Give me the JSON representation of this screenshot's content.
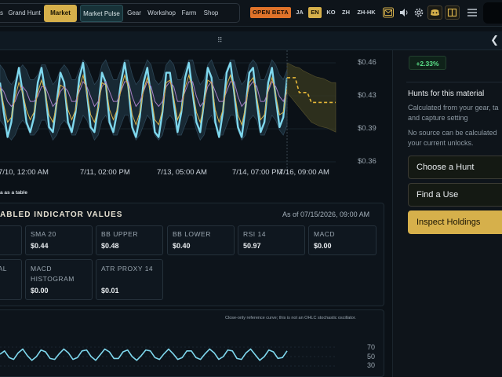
{
  "nav": {
    "items": [
      {
        "label": "s",
        "name": "nav-item-s"
      },
      {
        "label": "Grand Hunt",
        "name": "nav-item-grand-hunt"
      },
      {
        "label": "Market",
        "name": "nav-item-market"
      },
      {
        "label": "Market Pulse",
        "name": "nav-item-market-pulse"
      },
      {
        "label": "Gear",
        "name": "nav-item-gear"
      },
      {
        "label": "Workshop",
        "name": "nav-item-workshop"
      },
      {
        "label": "Farm",
        "name": "nav-item-farm"
      },
      {
        "label": "Shop",
        "name": "nav-item-shop"
      }
    ],
    "beta": "OPEN BETA",
    "languages": [
      "JA",
      "EN",
      "KO",
      "ZH",
      "ZH-HK"
    ],
    "active_language": "EN",
    "icons": [
      "mail-icon",
      "speaker-icon",
      "gear-icon",
      "discord-icon",
      "book-icon"
    ]
  },
  "colors": {
    "accent": "#d6b04b",
    "price_line": "#7fd8ee",
    "sma_line": "#d9b24a",
    "band_line": "#a77fc4",
    "forecast": "#e6b838",
    "positive": "#5ce38a"
  },
  "chart_data": {
    "type": "line",
    "y_ticks": [
      "$0.46",
      "$0.43",
      "$0.39",
      "$0.36"
    ],
    "x_ticks": [
      "7/10, 12:00 AM",
      "7/11, 02:00 PM",
      "7/13, 05:00 AM",
      "7/14, 07:00 PM",
      "7/16, 09:00 AM"
    ],
    "ylim": [
      0.36,
      0.46
    ],
    "series": [],
    "price_series": [
      0.44,
      0.41,
      0.385,
      0.4,
      0.435,
      0.455,
      0.43,
      0.4,
      0.39,
      0.405,
      0.44,
      0.455,
      0.43,
      0.395,
      0.39,
      0.42,
      0.45,
      0.44,
      0.4,
      0.39,
      0.41,
      0.445,
      0.46,
      0.43,
      0.395,
      0.39,
      0.415,
      0.45,
      0.44,
      0.4,
      0.39,
      0.41,
      0.44,
      0.46,
      0.435,
      0.395,
      0.385,
      0.405,
      0.44,
      0.455,
      0.425,
      0.39,
      0.385,
      0.41,
      0.45,
      0.45,
      0.42,
      0.39,
      0.41,
      0.445,
      0.46,
      0.43,
      0.4,
      0.39,
      0.42,
      0.455,
      0.445,
      0.4,
      0.385,
      0.41,
      0.45,
      0.46,
      0.43,
      0.395,
      0.385,
      0.415,
      0.45,
      0.455,
      0.42,
      0.39,
      0.4,
      0.44,
      0.455,
      0.425,
      0.395,
      0.405,
      0.445
    ],
    "sma_series": [
      0.43,
      0.425,
      0.415,
      0.41,
      0.415,
      0.425,
      0.43,
      0.425,
      0.415,
      0.415,
      0.42,
      0.43,
      0.43,
      0.42,
      0.41,
      0.415,
      0.425,
      0.43,
      0.425,
      0.415,
      0.415,
      0.425,
      0.435,
      0.43,
      0.42,
      0.41,
      0.415,
      0.43,
      0.435,
      0.425,
      0.415,
      0.415,
      0.425,
      0.435,
      0.435,
      0.42,
      0.41,
      0.415,
      0.425,
      0.435,
      0.43,
      0.415,
      0.41,
      0.415,
      0.43,
      0.435,
      0.43,
      0.415,
      0.415,
      0.425,
      0.435,
      0.435,
      0.42,
      0.41,
      0.415,
      0.43,
      0.435,
      0.425,
      0.415,
      0.415,
      0.425,
      0.435,
      0.435,
      0.42,
      0.41,
      0.415,
      0.43,
      0.435,
      0.43,
      0.415,
      0.415,
      0.425,
      0.435,
      0.43,
      0.42,
      0.415,
      0.425
    ],
    "forecast_series": [
      0.445,
      0.445,
      0.445,
      0.43,
      0.43,
      0.43,
      0.42,
      0.42,
      0.42,
      0.42,
      0.42,
      0.42,
      0.42
    ],
    "forecast_band_upper": [
      0.46,
      0.458,
      0.456,
      0.455,
      0.452,
      0.45,
      0.448,
      0.446,
      0.445,
      0.444,
      0.442,
      0.44,
      0.44
    ],
    "forecast_band_lower": [
      0.43,
      0.425,
      0.42,
      0.415,
      0.41,
      0.405,
      0.4,
      0.398,
      0.396,
      0.395,
      0.394,
      0.392,
      0.39
    ]
  },
  "main": {
    "table_link": "a as a table",
    "indicators_title": "ABLED INDICATOR VALUES",
    "as_of": "As of 07/15/2026, 09:00 AM",
    "cards": [
      {
        "label": "",
        "value": "",
        "name": "indicator-card-blank"
      },
      {
        "label": "SMA 20",
        "value": "$0.44",
        "name": "indicator-card-sma-20"
      },
      {
        "label": "BB UPPER",
        "value": "$0.48",
        "name": "indicator-card-bb-upper"
      },
      {
        "label": "BB LOWER",
        "value": "$0.40",
        "name": "indicator-card-bb-lower"
      },
      {
        "label": "RSI 14",
        "value": "50.97",
        "name": "indicator-card-rsi-14"
      },
      {
        "label": "MACD",
        "value": "$0.00",
        "name": "indicator-card-macd"
      },
      {
        "label": "NAL",
        "value": "",
        "name": "indicator-card-signal"
      },
      {
        "label": "MACD HISTOGRAM",
        "value": "$0.00",
        "name": "indicator-card-macd-histogram"
      },
      {
        "label": "ATR PROXY 14",
        "value": "$0.01",
        "name": "indicator-card-atr-proxy-14"
      }
    ],
    "osc_note": "Close-only reference curve; this is not an OHLC stochastic oscillator.",
    "osc_ticks": [
      "70",
      "50",
      "30"
    ],
    "osc_series": [
      55,
      62,
      48,
      44,
      58,
      66,
      52,
      42,
      50,
      64,
      60,
      46,
      44,
      56,
      66,
      58,
      44,
      48,
      62,
      64,
      50,
      42,
      54,
      66,
      60,
      46,
      46,
      60,
      64,
      50,
      42,
      52,
      64,
      62,
      48,
      44,
      56,
      66,
      56,
      44,
      48,
      62,
      62,
      48,
      44,
      56,
      66,
      58,
      44,
      50,
      64,
      62,
      46,
      44,
      58,
      66,
      54,
      42,
      50,
      64,
      60,
      46,
      48,
      62
    ]
  },
  "sidebar": {
    "change": "+2.33%",
    "hunts_title": "Hunts for this material",
    "desc_lines": [
      "Calculated from your gear, ta",
      "and capture setting"
    ],
    "note_lines": [
      "No source can be calculated",
      "your current unlocks."
    ],
    "buttons": [
      {
        "label": "Choose a Hunt",
        "name": "choose-a-hunt-button"
      },
      {
        "label": "Find a Use",
        "name": "find-a-use-button"
      },
      {
        "label": "Inspect Holdings",
        "name": "inspect-holdings-button"
      }
    ]
  }
}
